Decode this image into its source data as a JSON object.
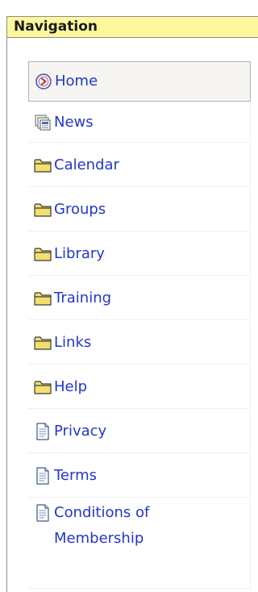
{
  "portlet": {
    "title": "Navigation"
  },
  "nav": {
    "items": [
      {
        "label": "Home",
        "icon": "home-icon"
      },
      {
        "label": "News",
        "icon": "news-icon"
      },
      {
        "label": "Calendar",
        "icon": "folder-icon"
      },
      {
        "label": "Groups",
        "icon": "folder-icon"
      },
      {
        "label": "Library",
        "icon": "folder-icon"
      },
      {
        "label": "Training",
        "icon": "folder-icon"
      },
      {
        "label": "Links",
        "icon": "folder-icon"
      },
      {
        "label": "Help",
        "icon": "folder-icon"
      },
      {
        "label": "Privacy",
        "icon": "document-icon"
      },
      {
        "label": "Terms",
        "icon": "document-icon"
      },
      {
        "label": "Conditions of Membership",
        "icon": "document-icon"
      }
    ],
    "selected": "Home"
  },
  "colors": {
    "header_bg": "#fef89d",
    "link": "#2337c9",
    "folder": "#f2df6e"
  }
}
